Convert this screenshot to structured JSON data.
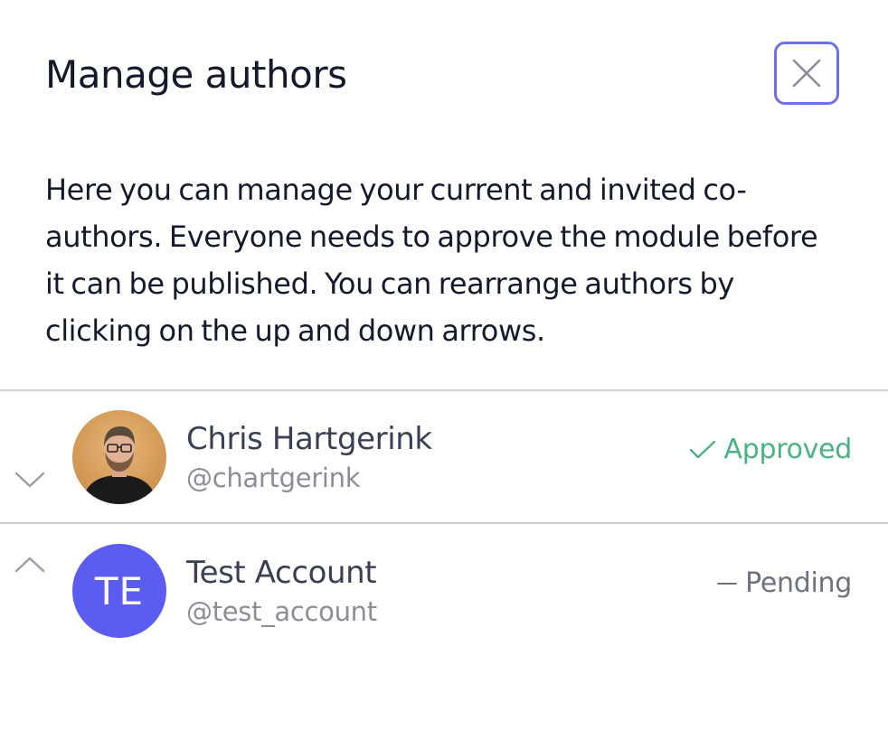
{
  "modal": {
    "title": "Manage authors",
    "description": "Here you can manage your current and invited co-authors. Everyone needs to approve the module before it can be published. You can rearrange authors by clicking on the up and down arrows."
  },
  "authors": [
    {
      "name": "Chris Hartgerink",
      "handle": "@chartgerink",
      "status": "Approved",
      "status_icon": "check-icon",
      "avatar_type": "photo",
      "move_arrow": "chevron-down-icon"
    },
    {
      "name": "Test Account",
      "handle": "@test_account",
      "status": "Pending",
      "status_icon": "dash-icon",
      "avatar_type": "initials",
      "initials": "TE",
      "move_arrow": "chevron-up-icon"
    }
  ],
  "colors": {
    "accent": "#6c70e6",
    "approved": "#4bb281",
    "pending": "#6e7180",
    "avatar_initials_bg": "#5b5cf0"
  }
}
